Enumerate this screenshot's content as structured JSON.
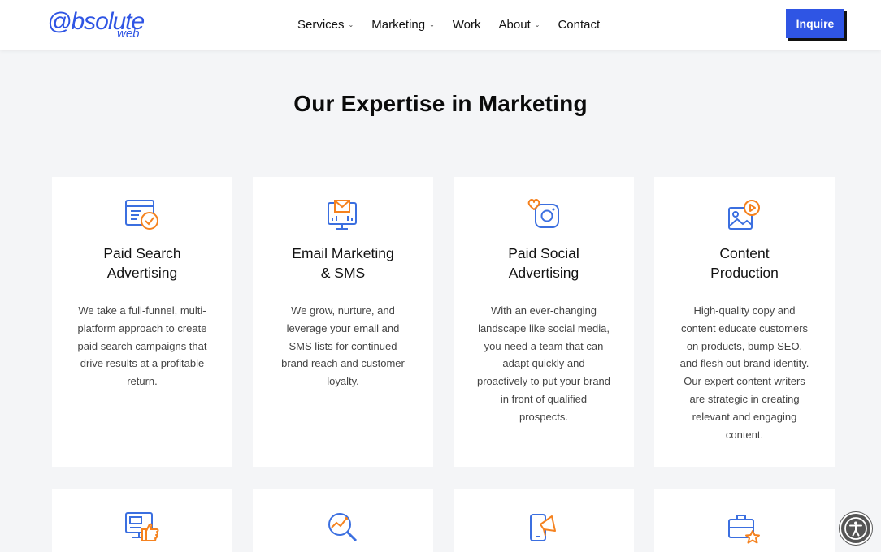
{
  "header": {
    "logo_main": "@bsolute",
    "logo_sub": "web",
    "nav": [
      {
        "label": "Services",
        "has_dropdown": true
      },
      {
        "label": "Marketing",
        "has_dropdown": true
      },
      {
        "label": "Work",
        "has_dropdown": false
      },
      {
        "label": "About",
        "has_dropdown": true
      },
      {
        "label": "Contact",
        "has_dropdown": false
      }
    ],
    "chevron": "⌄",
    "inquire_label": "Inquire"
  },
  "main": {
    "title": "Our Expertise in Marketing",
    "cards": [
      {
        "icon": "search-ad-icon",
        "title_line1": "Paid Search",
        "title_line2": "Advertising",
        "description": "We take a full-funnel, multi-platform approach to create paid search campaigns that drive results at a profitable return."
      },
      {
        "icon": "email-monitor-icon",
        "title_line1": "Email Marketing",
        "title_line2": "& SMS",
        "description": "We grow, nurture, and leverage your email and SMS lists for continued brand reach and customer loyalty."
      },
      {
        "icon": "social-heart-icon",
        "title_line1": "Paid Social",
        "title_line2": "Advertising",
        "description": "With an ever-changing landscape like social media, you need a team that can adapt quickly and proactively to put your brand in front of qualified prospects."
      },
      {
        "icon": "content-media-icon",
        "title_line1": "Content",
        "title_line2": "Production",
        "description": "High-quality copy and content educate customers on products, bump SEO, and flesh out brand identity. Our expert content writers are strategic in creating relevant and engaging content."
      }
    ],
    "cards_row2_icons": [
      "monitor-thumbs-up-icon",
      "analytics-search-icon",
      "mobile-megaphone-icon",
      "briefcase-star-icon"
    ]
  },
  "colors": {
    "brand_blue": "#2f55e4",
    "accent_orange": "#f5821f",
    "icon_blue": "#3b6fe0"
  }
}
